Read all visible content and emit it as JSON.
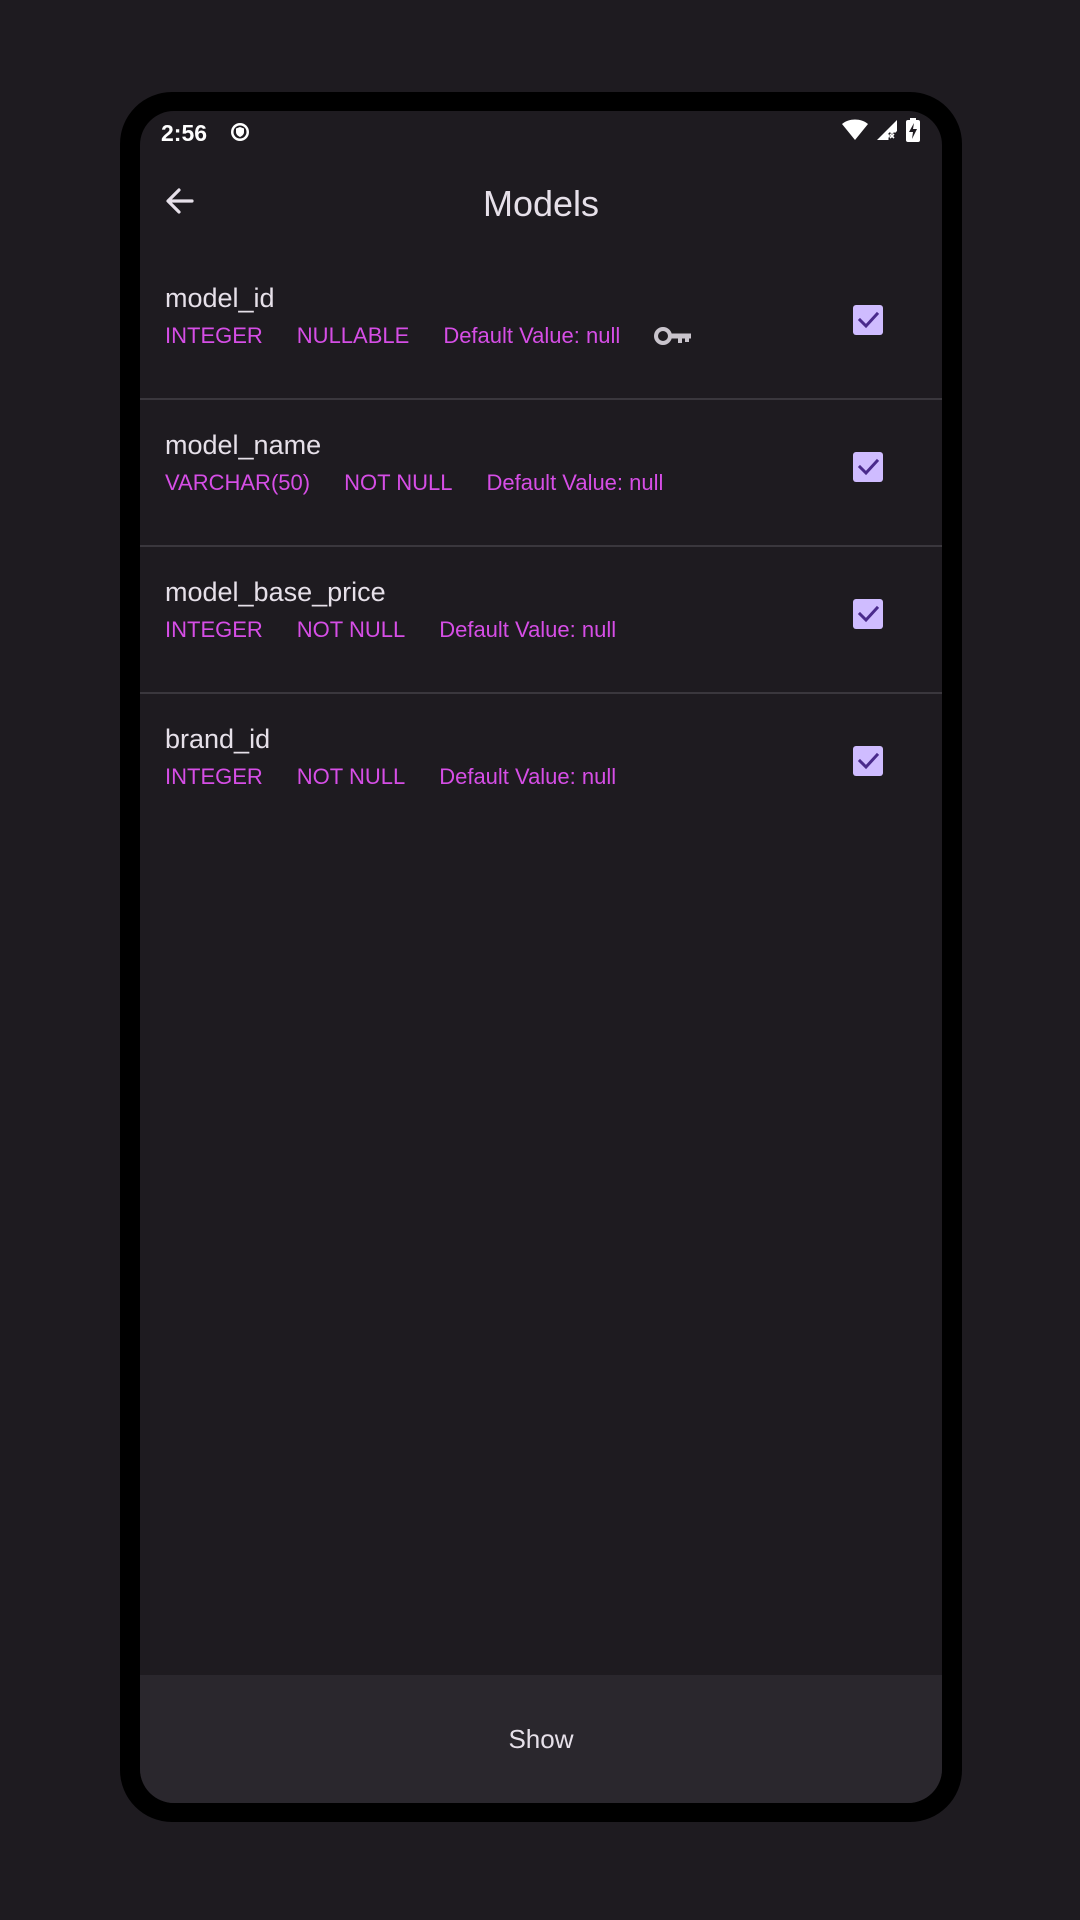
{
  "status_bar": {
    "time": "2:56",
    "left_icon": "shield-icon",
    "right_icons": [
      "wifi-icon",
      "signal-icon",
      "battery-charging-icon"
    ]
  },
  "app_bar": {
    "back_icon": "arrow-back-icon",
    "title": "Models"
  },
  "colors": {
    "background": "#1e1b20",
    "title_text": "#e6e0e9",
    "meta_text": "#d64ee6",
    "checkbox_fill": "#cfbcff",
    "checkmark": "#4a2a8c",
    "divider": "#3a373d",
    "bottom_bar": "#2a272d",
    "key_icon": "#c9c4cc"
  },
  "columns": [
    {
      "name": "model_id",
      "type": "INTEGER",
      "nullability": "NULLABLE",
      "default": "Default Value: null",
      "primary_key": true,
      "checked": true
    },
    {
      "name": "model_name",
      "type": "VARCHAR(50)",
      "nullability": "NOT NULL",
      "default": "Default Value: null",
      "primary_key": false,
      "checked": true
    },
    {
      "name": "model_base_price",
      "type": "INTEGER",
      "nullability": "NOT NULL",
      "default": "Default Value: null",
      "primary_key": false,
      "checked": true
    },
    {
      "name": "brand_id",
      "type": "INTEGER",
      "nullability": "NOT NULL",
      "default": "Default Value: null",
      "primary_key": false,
      "checked": true
    }
  ],
  "bottom_button": {
    "label": "Show"
  }
}
